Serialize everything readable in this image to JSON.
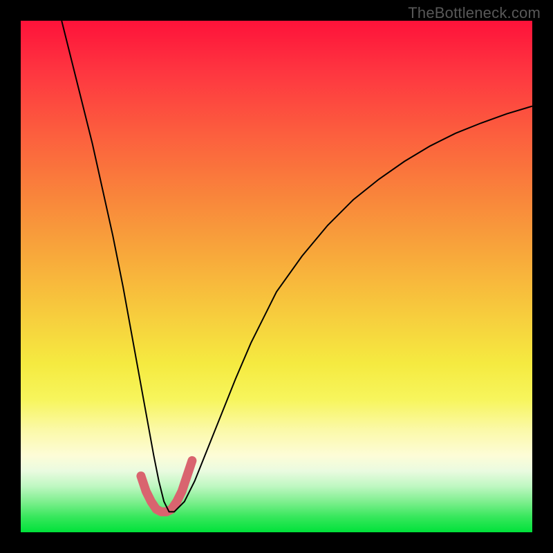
{
  "watermark": "TheBottleneck.com",
  "chart_data": {
    "type": "line",
    "title": "",
    "xlabel": "",
    "ylabel": "",
    "xlim": [
      0,
      100
    ],
    "ylim": [
      0,
      100
    ],
    "gradient_stops": [
      {
        "pct": 0,
        "color": "#fe123a"
      },
      {
        "pct": 10,
        "color": "#fe3640"
      },
      {
        "pct": 22,
        "color": "#fc5e3e"
      },
      {
        "pct": 34,
        "color": "#f9843b"
      },
      {
        "pct": 46,
        "color": "#f8a93b"
      },
      {
        "pct": 57,
        "color": "#f7cb3d"
      },
      {
        "pct": 67,
        "color": "#f5ea40"
      },
      {
        "pct": 74,
        "color": "#f7f55c"
      },
      {
        "pct": 80,
        "color": "#fbf9a8"
      },
      {
        "pct": 85,
        "color": "#fdfcd7"
      },
      {
        "pct": 88,
        "color": "#eafbe0"
      },
      {
        "pct": 91,
        "color": "#bff7c2"
      },
      {
        "pct": 94,
        "color": "#7fef8f"
      },
      {
        "pct": 97,
        "color": "#37e75c"
      },
      {
        "pct": 100,
        "color": "#00e23a"
      }
    ],
    "series": [
      {
        "name": "bottleneck-curve",
        "color": "#000000",
        "x": [
          8,
          10,
          12,
          14,
          16,
          18,
          20,
          22,
          24,
          26,
          27,
          28,
          29,
          30,
          32,
          34,
          36,
          38,
          40,
          42,
          45,
          50,
          55,
          60,
          65,
          70,
          75,
          80,
          85,
          90,
          95,
          100
        ],
        "y": [
          100,
          92,
          84,
          76,
          67,
          58,
          48,
          37,
          26,
          15,
          10,
          6,
          4,
          4,
          6,
          10,
          15,
          20,
          25,
          30,
          37,
          47,
          54,
          60,
          65,
          69,
          72.5,
          75.5,
          78,
          80,
          81.8,
          83.3
        ]
      },
      {
        "name": "bottom-highlight",
        "color": "#d9646f",
        "stroke_width": 13,
        "x": [
          23.5,
          24.5,
          25.5,
          26.5,
          27.5,
          28.5,
          29.5,
          30.5,
          31.5,
          32.5,
          33.5
        ],
        "y": [
          11,
          8,
          6,
          4.5,
          4,
          4,
          4.5,
          6,
          8,
          11,
          14
        ]
      }
    ],
    "annotations": []
  }
}
